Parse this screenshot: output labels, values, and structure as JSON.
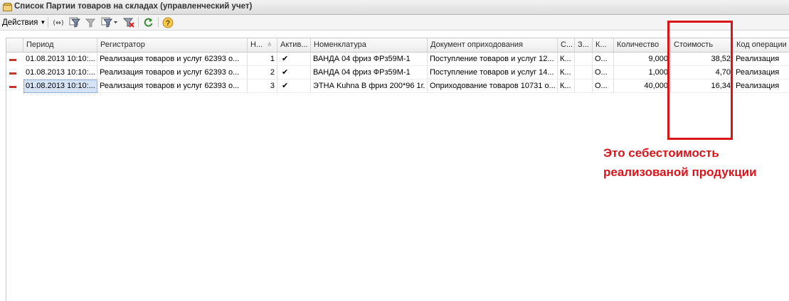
{
  "window": {
    "title": "Список Партии товаров на складах (управленческий учет)"
  },
  "toolbar": {
    "actions_label": "Действия"
  },
  "table": {
    "columns": [
      "Период",
      "Регистратор",
      "Н...",
      "Актив...",
      "Номенклатура",
      "Документ оприходования",
      "С...",
      "З...",
      "К...",
      "Количество",
      "Стоимость",
      "Код операции"
    ],
    "rows": [
      [
        "01.08.2013 10:10:...",
        "Реализация товаров и услуг 62393 о...",
        "1",
        "✔",
        "ВАНДА 04 фриз ФРз59М-1",
        "Поступление товаров и услуг 12...",
        "К...",
        "",
        "О...",
        "9,000",
        "38,52",
        "Реализация"
      ],
      [
        "01.08.2013 10:10:...",
        "Реализация товаров и услуг 62393 о...",
        "2",
        "✔",
        "ВАНДА 04 фриз ФРз59М-1",
        "Поступление товаров и услуг 14...",
        "К...",
        "",
        "О...",
        "1,000",
        "4,70",
        "Реализация"
      ],
      [
        "01.08.2013 10:10:...",
        "Реализация товаров и услуг 62393 о...",
        "3",
        "✔",
        "ЭТНА Kuhna В фриз 200*96 1г.",
        "Оприходование товаров 10731 о...",
        "К...",
        "",
        "О...",
        "40,000",
        "16,34",
        "Реализация"
      ]
    ]
  },
  "annotation": {
    "line1": "Это себестоимость",
    "line2": "реализованой продукции",
    "color": "#d9141b"
  }
}
